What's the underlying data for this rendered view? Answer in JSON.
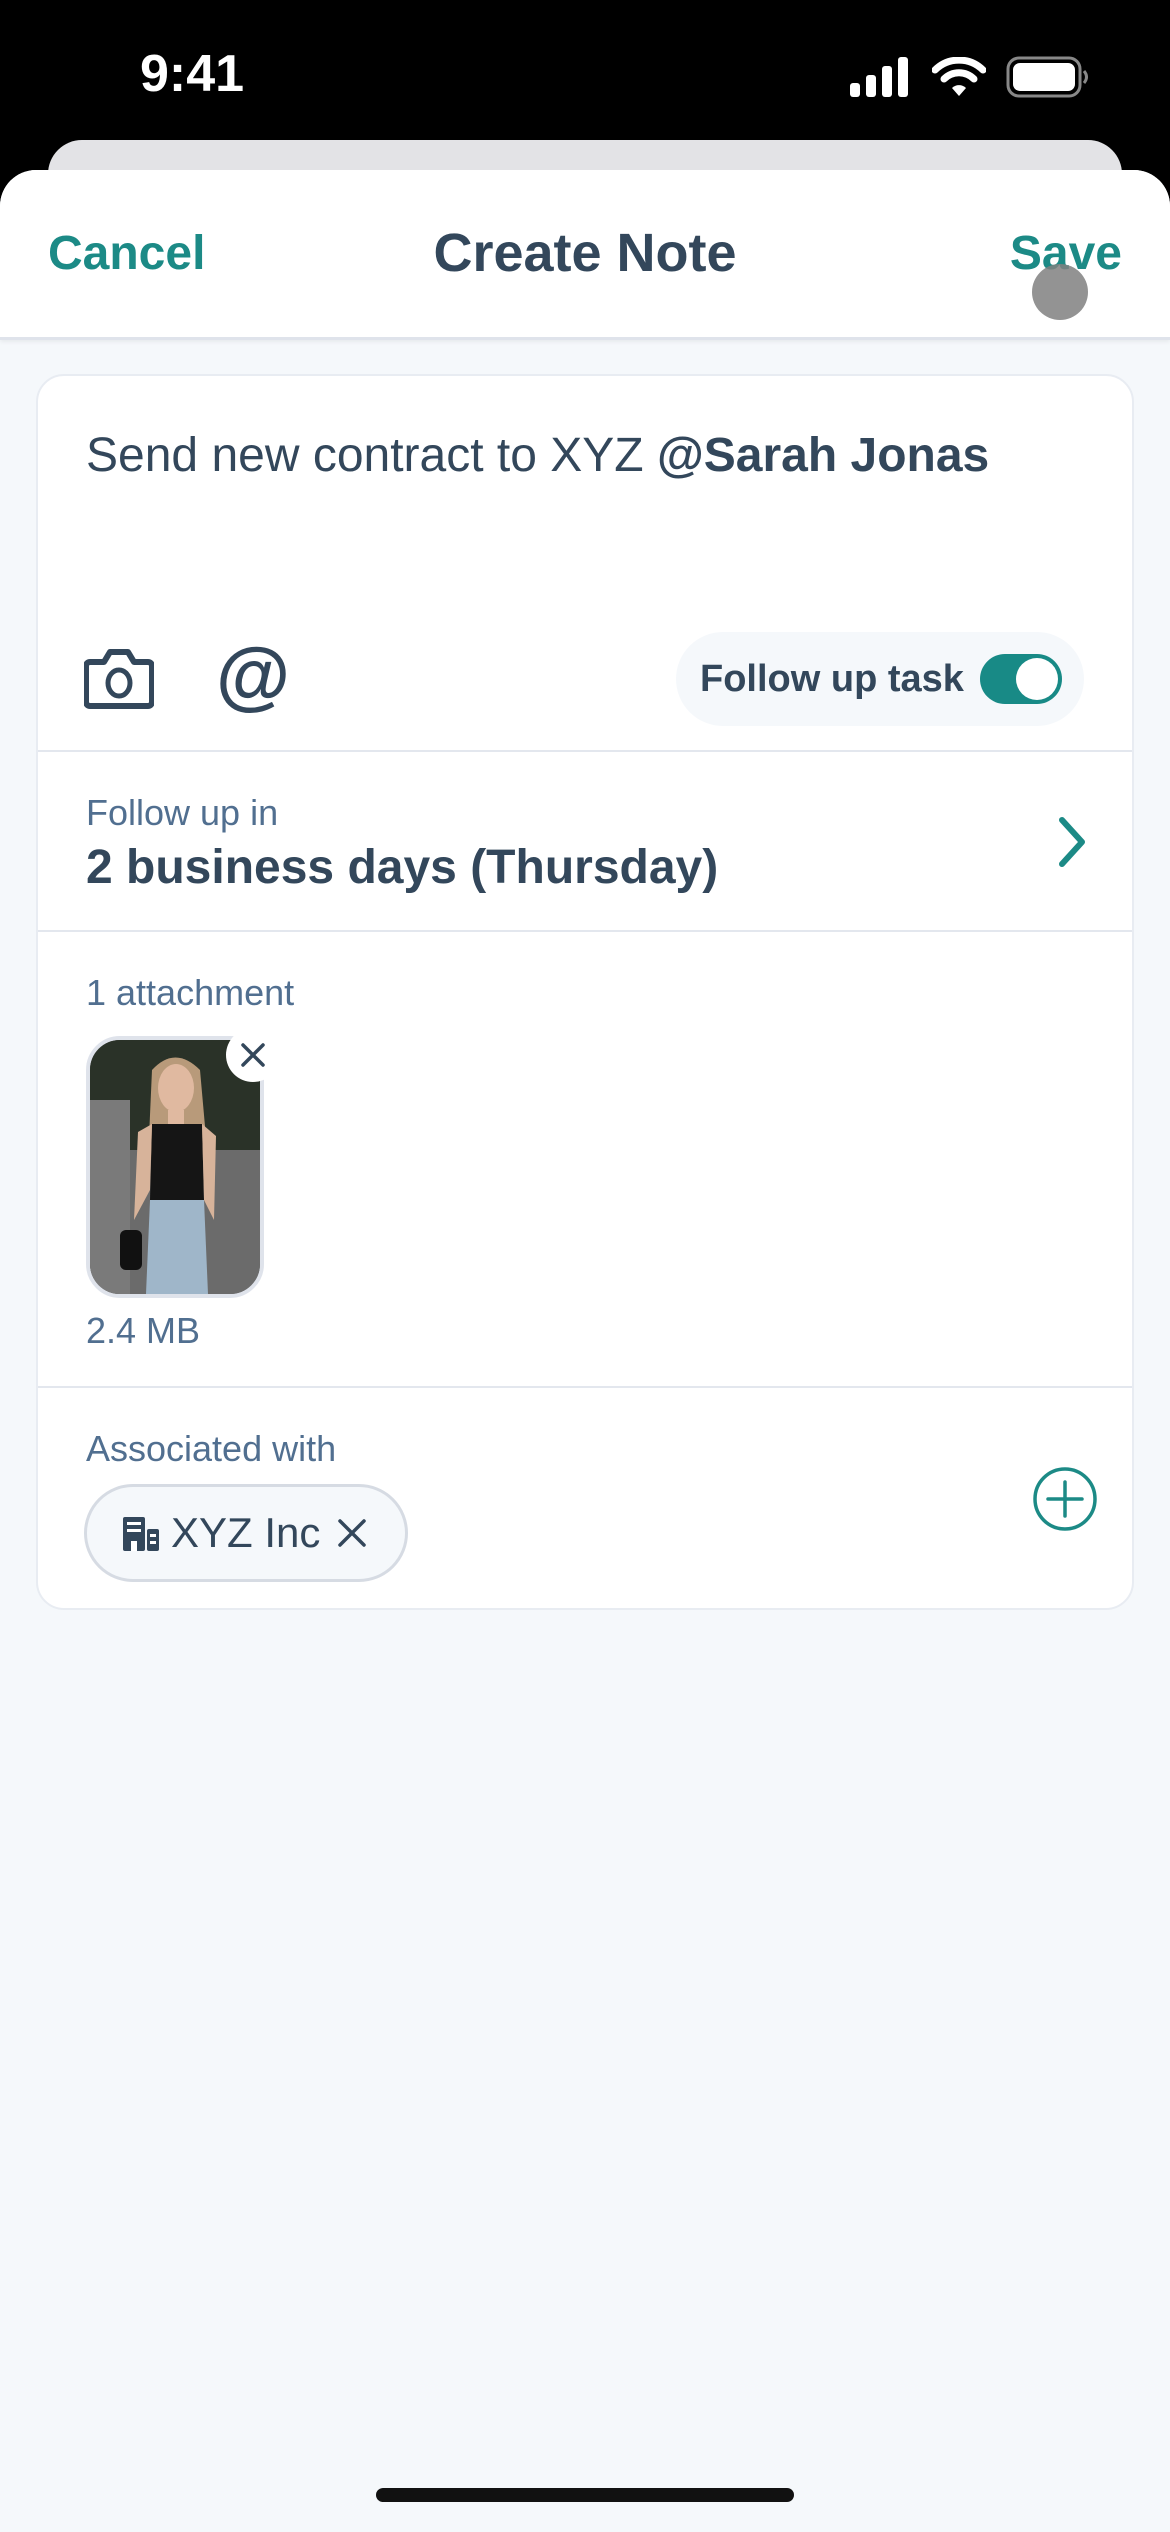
{
  "status_bar": {
    "time": "9:41",
    "icons": [
      "cellular-signal-icon",
      "wifi-icon",
      "battery-icon"
    ]
  },
  "nav": {
    "cancel_label": "Cancel",
    "title": "Create Note",
    "save_label": "Save"
  },
  "note": {
    "text": "Send new contract to XYZ ",
    "mention": "@Sarah Jonas",
    "toolbar": {
      "camera_icon": "camera-icon",
      "mention_icon": "@"
    },
    "follow_up_task": {
      "label": "Follow up task",
      "enabled": true
    }
  },
  "follow_up": {
    "caption": "Follow up in",
    "value": "2 business days (Thursday)"
  },
  "attachments": {
    "caption": "1 attachment",
    "items": [
      {
        "type": "image",
        "size": "2.4 MB"
      }
    ]
  },
  "associations": {
    "caption": "Associated with",
    "chips": [
      {
        "icon": "building-icon",
        "label": "XYZ Inc"
      }
    ]
  },
  "colors": {
    "accent": "#1c8a86",
    "text_primary": "#33475b",
    "text_secondary": "#516f90",
    "background": "#f5f8fb"
  }
}
